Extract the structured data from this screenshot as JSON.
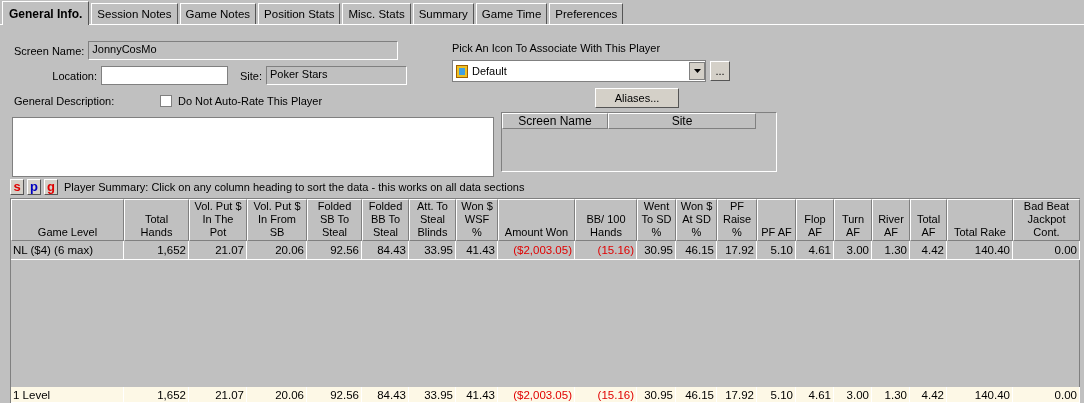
{
  "tabs": [
    {
      "label": "General Info.",
      "selected": true
    },
    {
      "label": "Session Notes",
      "selected": false
    },
    {
      "label": "Game Notes",
      "selected": false
    },
    {
      "label": "Position Stats",
      "selected": false
    },
    {
      "label": "Misc. Stats",
      "selected": false
    },
    {
      "label": "Summary",
      "selected": false
    },
    {
      "label": "Game Time",
      "selected": false
    },
    {
      "label": "Preferences",
      "selected": false
    }
  ],
  "form": {
    "screen_name_label": "Screen Name:",
    "screen_name": "JonnyCosMo",
    "location_label": "Location:",
    "site_label": "Site:",
    "site": "Poker Stars",
    "icon_label": "Pick An Icon To Associate With This Player",
    "icon_value": "Default",
    "more_button": "...",
    "description_label": "General Description:",
    "auto_rate_label": "Do Not Auto-Rate This Player",
    "auto_rate_checked": false,
    "aliases_button": "Aliases...",
    "alias_columns": [
      "Screen Name",
      "Site"
    ]
  },
  "summary_bar": {
    "buttons": [
      {
        "label": "s",
        "color": "#e00000"
      },
      {
        "label": "p",
        "color": "#0000c0"
      },
      {
        "label": "g",
        "color": "#e00000"
      }
    ],
    "text": "Player Summary: Click on any column heading to sort the data - this works on all data sections"
  },
  "table": {
    "columns": [
      "Game Level",
      "Total Hands",
      "Vol. Put $ In The Pot",
      "Vol. Put $ In From SB",
      "Folded SB To Steal",
      "Folded BB To Steal",
      "Att. To Steal Blinds",
      "Won $ WSF %",
      "Amount Won",
      "BB/ 100 Hands",
      "Went To SD %",
      "Won $ At SD %",
      "PF Raise %",
      "PF AF",
      "Flop AF",
      "Turn AF",
      "River AF",
      "Total AF",
      "Total Rake",
      "Bad Beat Jackpot Cont."
    ],
    "rows": [
      {
        "kind": "game",
        "cells": [
          "NL ($4) (6 max)",
          "1,652",
          "21.07",
          "20.06",
          "92.56",
          "84.43",
          "33.95",
          "41.43",
          {
            "text": "($2,003.05)",
            "negative": true
          },
          {
            "text": "(15.16)",
            "negative": true
          },
          "30.95",
          "46.15",
          "17.92",
          "5.10",
          "4.61",
          "3.00",
          "1.30",
          "4.42",
          "140.40",
          "0.00"
        ]
      },
      {
        "kind": "total",
        "cells": [
          "1 Level",
          "1,652",
          "21.07",
          "20.06",
          "92.56",
          "84.43",
          "33.95",
          "41.43",
          {
            "text": "($2,003.05)",
            "negative": true
          },
          {
            "text": "(15.16)",
            "negative": true
          },
          "30.95",
          "46.15",
          "17.92",
          "5.10",
          "4.61",
          "3.00",
          "1.30",
          "4.42",
          "140.40",
          "0.00"
        ]
      }
    ]
  }
}
